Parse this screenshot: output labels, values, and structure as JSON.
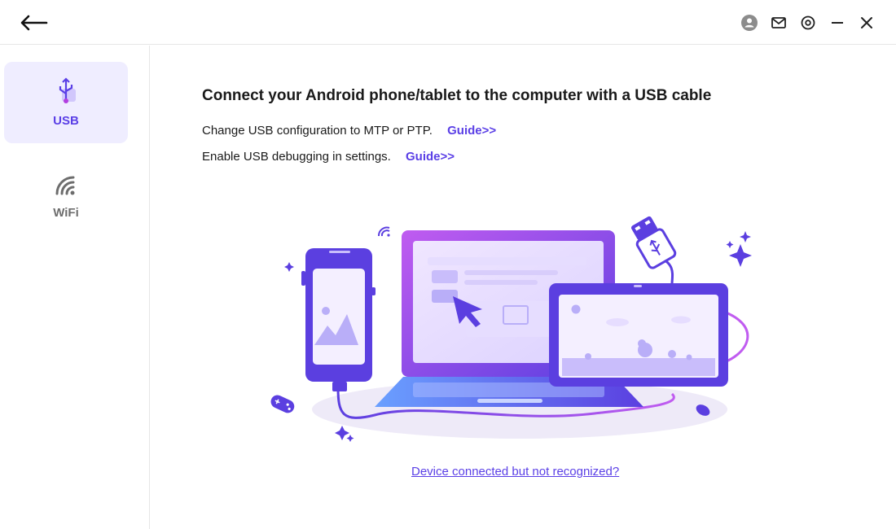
{
  "header": {
    "icons": [
      "back-arrow-icon",
      "user-avatar-icon",
      "mail-icon",
      "settings-icon",
      "minimize-icon",
      "close-icon"
    ]
  },
  "sidebar": {
    "items": [
      {
        "label": "USB",
        "icon": "usb-icon",
        "active": true
      },
      {
        "label": "WiFi",
        "icon": "wifi-icon",
        "active": false
      }
    ]
  },
  "main": {
    "title": "Connect your Android phone/tablet to the computer with a USB cable",
    "steps": [
      {
        "text": "Change USB configuration to MTP or PTP.",
        "link": "Guide>>"
      },
      {
        "text": "Enable USB debugging in settings.",
        "link": "Guide>>"
      }
    ],
    "help_link": "Device connected but not recognized?"
  },
  "colors": {
    "accent": "#5a3fe6",
    "active_bg": "#efedff",
    "border": "#e6e6e6"
  }
}
